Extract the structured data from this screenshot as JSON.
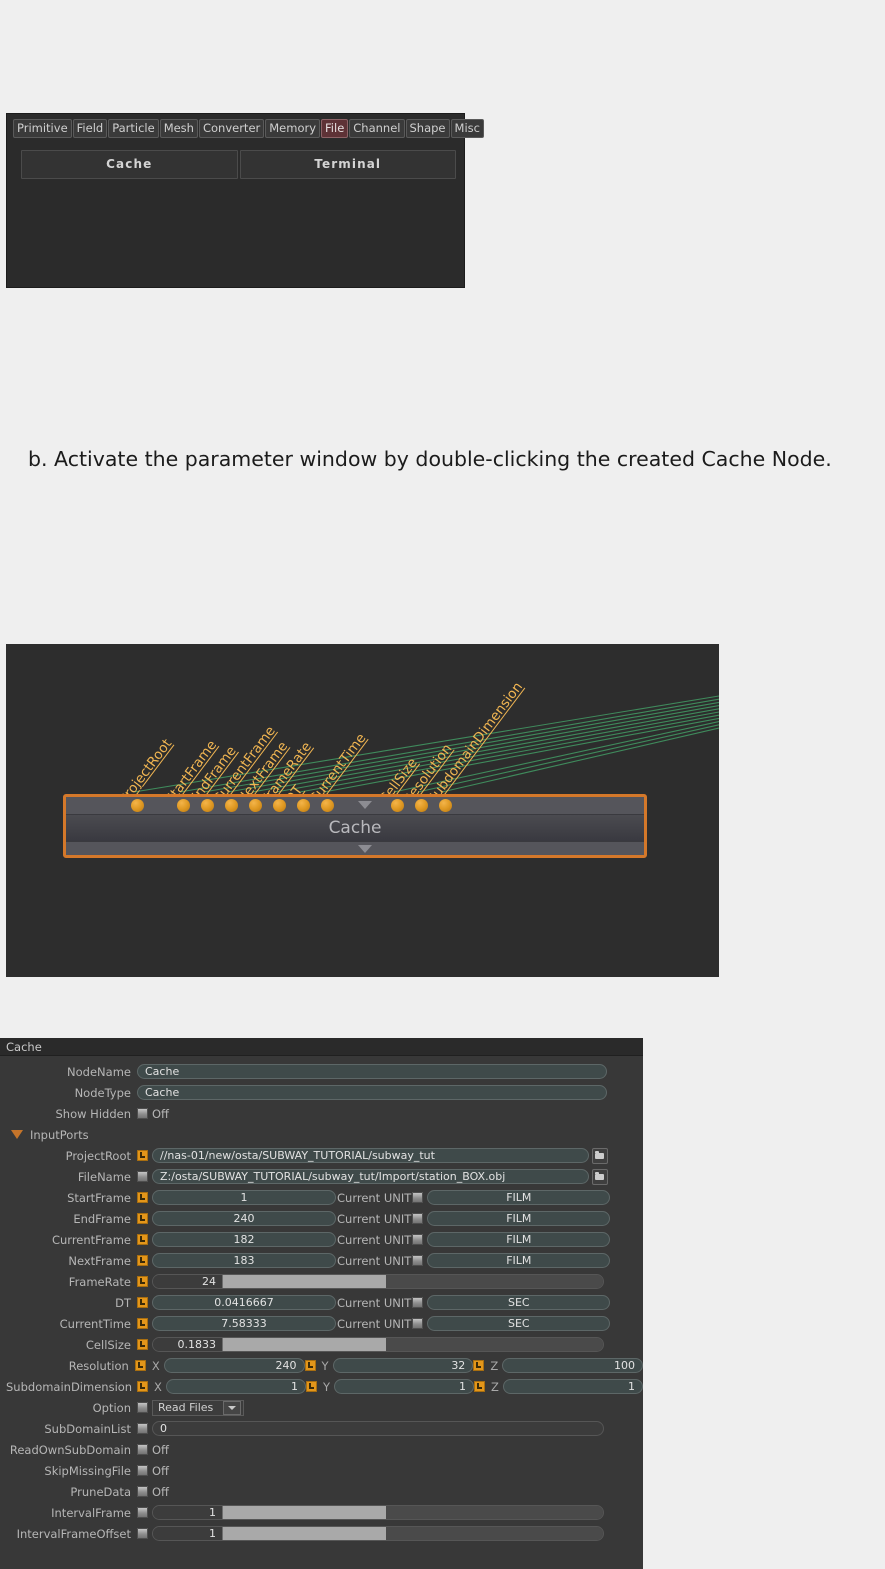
{
  "toolbar": {
    "tabs": [
      {
        "label": "Primitive",
        "active": false
      },
      {
        "label": "Field",
        "active": false
      },
      {
        "label": "Particle",
        "active": false
      },
      {
        "label": "Mesh",
        "active": false
      },
      {
        "label": "Converter",
        "active": false
      },
      {
        "label": "Memory",
        "active": false
      },
      {
        "label": "File",
        "active": true
      },
      {
        "label": "Channel",
        "active": false
      },
      {
        "label": "Shape",
        "active": false
      },
      {
        "label": "Misc",
        "active": false
      }
    ],
    "buttons": [
      {
        "label": "Cache"
      },
      {
        "label": "Terminal"
      }
    ],
    "active_tab_color": "#5e3236"
  },
  "instruction": {
    "text": "b. Activate the parameter window by double-clicking the created Cache Node."
  },
  "graph": {
    "node_title": "Cache",
    "node_border_color": "#d4782a",
    "port_color": "#e09a24",
    "wire_color": "#3f8b5c",
    "port_labels": [
      "ProjectRoot",
      "StartFrame",
      "EndFrame",
      "CurrentFrame",
      "NextFrame",
      "FrameRate",
      "DT",
      "CurrentTime",
      "CellSize",
      "Resolution",
      "SubdomainDimension"
    ]
  },
  "param_window": {
    "title": "Cache",
    "rows": [
      {
        "kind": "text",
        "label": "NodeName",
        "value": "Cache"
      },
      {
        "kind": "text",
        "label": "NodeType",
        "value": "Cache"
      },
      {
        "kind": "toggle",
        "label": "Show Hidden",
        "connected": false,
        "value": "Off"
      },
      {
        "kind": "group",
        "label": "InputPorts"
      },
      {
        "kind": "path",
        "label": "ProjectRoot",
        "connected": true,
        "value": "//nas-01/new/osta/SUBWAY_TUTORIAL/subway_tut"
      },
      {
        "kind": "path",
        "label": "FileName",
        "connected": false,
        "value": "Z:/osta/SUBWAY_TUTORIAL/subway_tut/Import/station_BOX.obj"
      },
      {
        "kind": "value_unit",
        "label": "StartFrame",
        "connected": true,
        "value": "1",
        "unit_label": "Current UNIT",
        "unit_connected": false,
        "unit_value": "FILM"
      },
      {
        "kind": "value_unit",
        "label": "EndFrame",
        "connected": true,
        "value": "240",
        "unit_label": "Current UNIT",
        "unit_connected": false,
        "unit_value": "FILM"
      },
      {
        "kind": "value_unit",
        "label": "CurrentFrame",
        "connected": true,
        "value": "182",
        "unit_label": "Current UNIT",
        "unit_connected": false,
        "unit_value": "FILM"
      },
      {
        "kind": "value_unit",
        "label": "NextFrame",
        "connected": true,
        "value": "183",
        "unit_label": "Current UNIT",
        "unit_connected": false,
        "unit_value": "FILM"
      },
      {
        "kind": "slider",
        "label": "FrameRate",
        "connected": true,
        "value": "24",
        "fill_pct": 43
      },
      {
        "kind": "value_unit",
        "label": "DT",
        "connected": true,
        "value": "0.0416667",
        "unit_label": "Current UNIT",
        "unit_connected": false,
        "unit_value": "SEC"
      },
      {
        "kind": "value_unit",
        "label": "CurrentTime",
        "connected": true,
        "value": "7.58333",
        "unit_label": "Current UNIT",
        "unit_connected": false,
        "unit_value": "SEC"
      },
      {
        "kind": "slider",
        "label": "CellSize",
        "connected": true,
        "value": "0.1833",
        "fill_pct": 43
      },
      {
        "kind": "xyz",
        "label": "Resolution",
        "axes": [
          {
            "name": "X",
            "connected": true,
            "value": "240"
          },
          {
            "name": "Y",
            "connected": true,
            "value": "32"
          },
          {
            "name": "Z",
            "connected": true,
            "value": "100"
          }
        ]
      },
      {
        "kind": "xyz",
        "label": "SubdomainDimension",
        "axes": [
          {
            "name": "X",
            "connected": true,
            "value": "1"
          },
          {
            "name": "Y",
            "connected": true,
            "value": "1"
          },
          {
            "name": "Z",
            "connected": true,
            "value": "1"
          }
        ]
      },
      {
        "kind": "dropdown",
        "label": "Option",
        "connected": false,
        "value": "Read Files"
      },
      {
        "kind": "text_plain",
        "label": "SubDomainList",
        "connected": false,
        "value": "0"
      },
      {
        "kind": "toggle",
        "label": "ReadOwnSubDomain",
        "connected": false,
        "value": "Off"
      },
      {
        "kind": "toggle",
        "label": "SkipMissingFile",
        "connected": false,
        "value": "Off"
      },
      {
        "kind": "toggle",
        "label": "PruneData",
        "connected": false,
        "value": "Off"
      },
      {
        "kind": "slider",
        "label": "IntervalFrame",
        "connected": false,
        "value": "1",
        "fill_pct": 43
      },
      {
        "kind": "slider",
        "label": "IntervalFrameOffset",
        "connected": false,
        "value": "1",
        "fill_pct": 43
      }
    ]
  }
}
